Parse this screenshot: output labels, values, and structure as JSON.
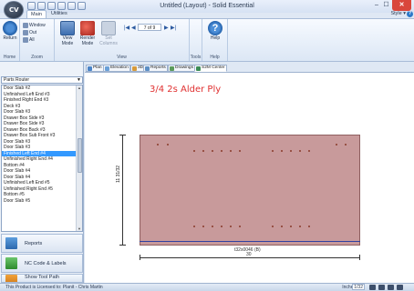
{
  "window": {
    "title": "Untitled (Layout) - Solid Essential",
    "minimize": "–",
    "maximize": "☐",
    "close": "✕"
  },
  "app_button": {
    "label": "CV"
  },
  "ribbon": {
    "tabs": [
      "Main",
      "Utilities"
    ],
    "style_menu": "Style ▾",
    "help_glyph": "?",
    "home": {
      "return_label": "Return",
      "group_label": "Home"
    },
    "zoom": {
      "window_label": "Window",
      "out_label": "Out",
      "all_label": "All",
      "group_label": "Zoom"
    },
    "view": {
      "view_mode_label": "View Mode",
      "render_mode_label": "Render Mode",
      "set_columns_label": "Set Columns",
      "page_indicator": "7 of 9",
      "group_label": "View"
    },
    "tools": {
      "group_label": "Tools"
    },
    "help": {
      "help_label": "Help",
      "group_label": "Help"
    }
  },
  "left_panel": {
    "route_select": "Parts Router",
    "parts": [
      "Door Slab #2",
      "Unfinished Left End #3",
      "Finished Right End #3",
      "Deck #3",
      "Door Slab #3",
      "Drawer Box Side #3",
      "Drawer Box Side #3",
      "Drawer Box Back #3",
      "Drawer Box Sub Front #3",
      "Door Slab #3",
      "Door Slab #3",
      "Finished Left End #4",
      "Unfinished Right End #4",
      "Bottom #4",
      "Door Slab #4",
      "Door Slab #4",
      "Unfinished Left End #5",
      "Unfinished Right End #5",
      "Bottom #5",
      "Door Slab #5"
    ],
    "selected_index": 11,
    "nav_buttons": [
      "Reports",
      "NC Code & Labels",
      "Show Tool Path"
    ]
  },
  "doc_tabs": [
    "Plan",
    "Elevation",
    "3D",
    "Reports",
    "Drawings",
    "S2M Center"
  ],
  "active_doc_tab": 5,
  "canvas": {
    "material_label": "3/4 2s Alder Ply",
    "sheet_height_label": "11 31/32",
    "sheet_code": "t32s0046 (B)",
    "sheet_width_label": "30"
  },
  "status_bar": {
    "text": "This Product is Licensed to: Planit - Chris Martin",
    "units": "Inches",
    "fraction": "1/32"
  }
}
